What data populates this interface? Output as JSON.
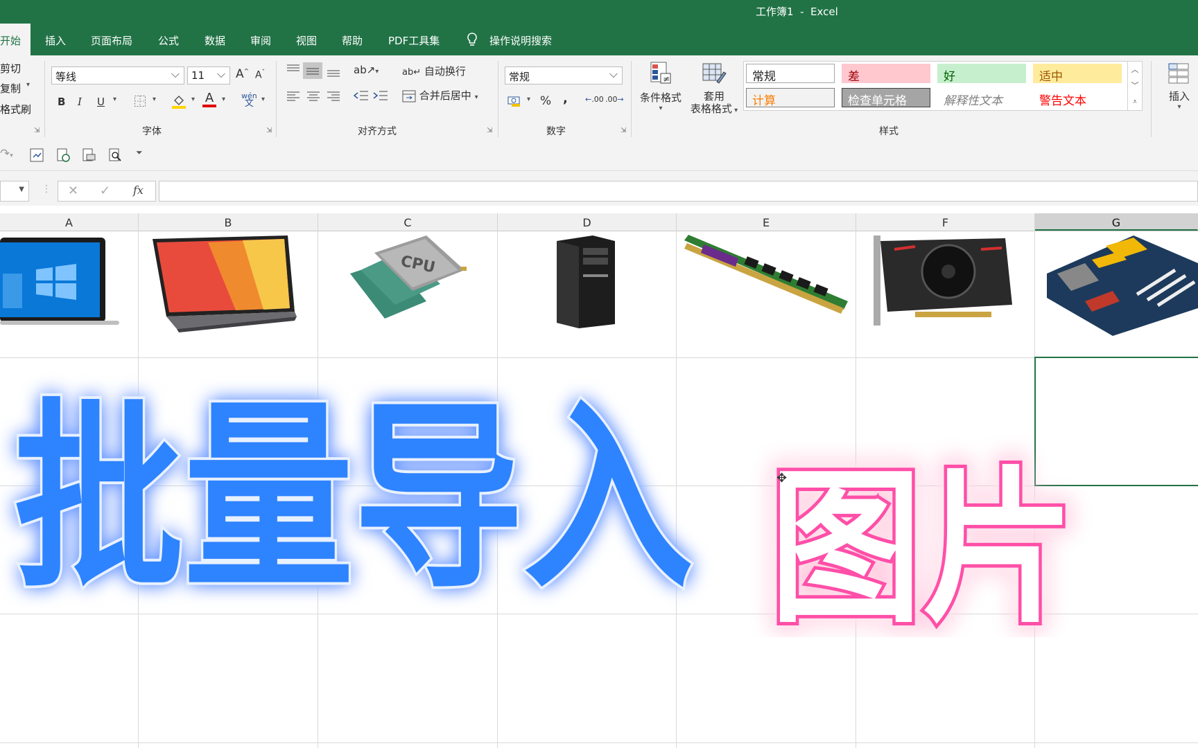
{
  "window": {
    "title": "工作簿1  -  Excel"
  },
  "tabs": [
    "开始",
    "插入",
    "页面布局",
    "公式",
    "数据",
    "审阅",
    "视图",
    "帮助",
    "PDF工具集"
  ],
  "search_label": "操作说明搜索",
  "clipboard": {
    "cut": "剪切",
    "copy": "复制",
    "format_painter": "格式刷"
  },
  "font": {
    "name": "等线",
    "size": "11",
    "bold": "B",
    "italic": "I",
    "underline": "U",
    "grow": "A",
    "shrink": "A",
    "phonetic": "wén",
    "group_label": "字体"
  },
  "alignment": {
    "wrap": "自动换行",
    "merge": "合并后居中",
    "group_label": "对齐方式"
  },
  "number": {
    "format": "常规",
    "percent": "%",
    "comma": ",",
    "inc_decimal": ".00",
    "dec_decimal": ".00",
    "group_label": "数字"
  },
  "styles": {
    "conditional_format": "条件格式",
    "table_format_1": "套用",
    "table_format_2": "表格格式",
    "cells": [
      {
        "label": "常规",
        "bg": "#ffffff",
        "color": "#222222",
        "border": "#a6a6a6"
      },
      {
        "label": "差",
        "bg": "#ffc7ce",
        "color": "#9c0006",
        "border": "#ffc7ce"
      },
      {
        "label": "好",
        "bg": "#c6efce",
        "color": "#006100",
        "border": "#c6efce"
      },
      {
        "label": "适中",
        "bg": "#ffeb9c",
        "color": "#9c5700",
        "border": "#ffeb9c"
      },
      {
        "label": "计算",
        "bg": "#f2f2f2",
        "color": "#fa7d00",
        "border": "#7f7f7f"
      },
      {
        "label": "检查单元格",
        "bg": "#a5a5a5",
        "color": "#ffffff",
        "border": "#3f3f3f"
      },
      {
        "label": "解释性文本",
        "bg": "#ffffff",
        "color": "#7f7f7f",
        "border": "#ffffff"
      },
      {
        "label": "警告文本",
        "bg": "#ffffff",
        "color": "#ff0000",
        "border": "#ffffff"
      }
    ],
    "group_label": "样式"
  },
  "cells_group": {
    "insert": "插入"
  },
  "formula_bar": {
    "fx": "fx",
    "value": ""
  },
  "columns": [
    "A",
    "B",
    "C",
    "D",
    "E",
    "F",
    "G"
  ],
  "selected_column": "G",
  "images": [
    "laptop-windows",
    "laptop-colorful",
    "cpu-chips",
    "pc-tower",
    "ram-module",
    "graphics-card",
    "motherboard"
  ],
  "image_texts": {
    "cpu": "CPU"
  },
  "overlay": {
    "title_blue": "批量导入",
    "title_pink": "图片"
  },
  "colors": {
    "excel_green": "#217346",
    "blue_text": "#2f83ff",
    "pink_glow": "#ff4fa8"
  }
}
